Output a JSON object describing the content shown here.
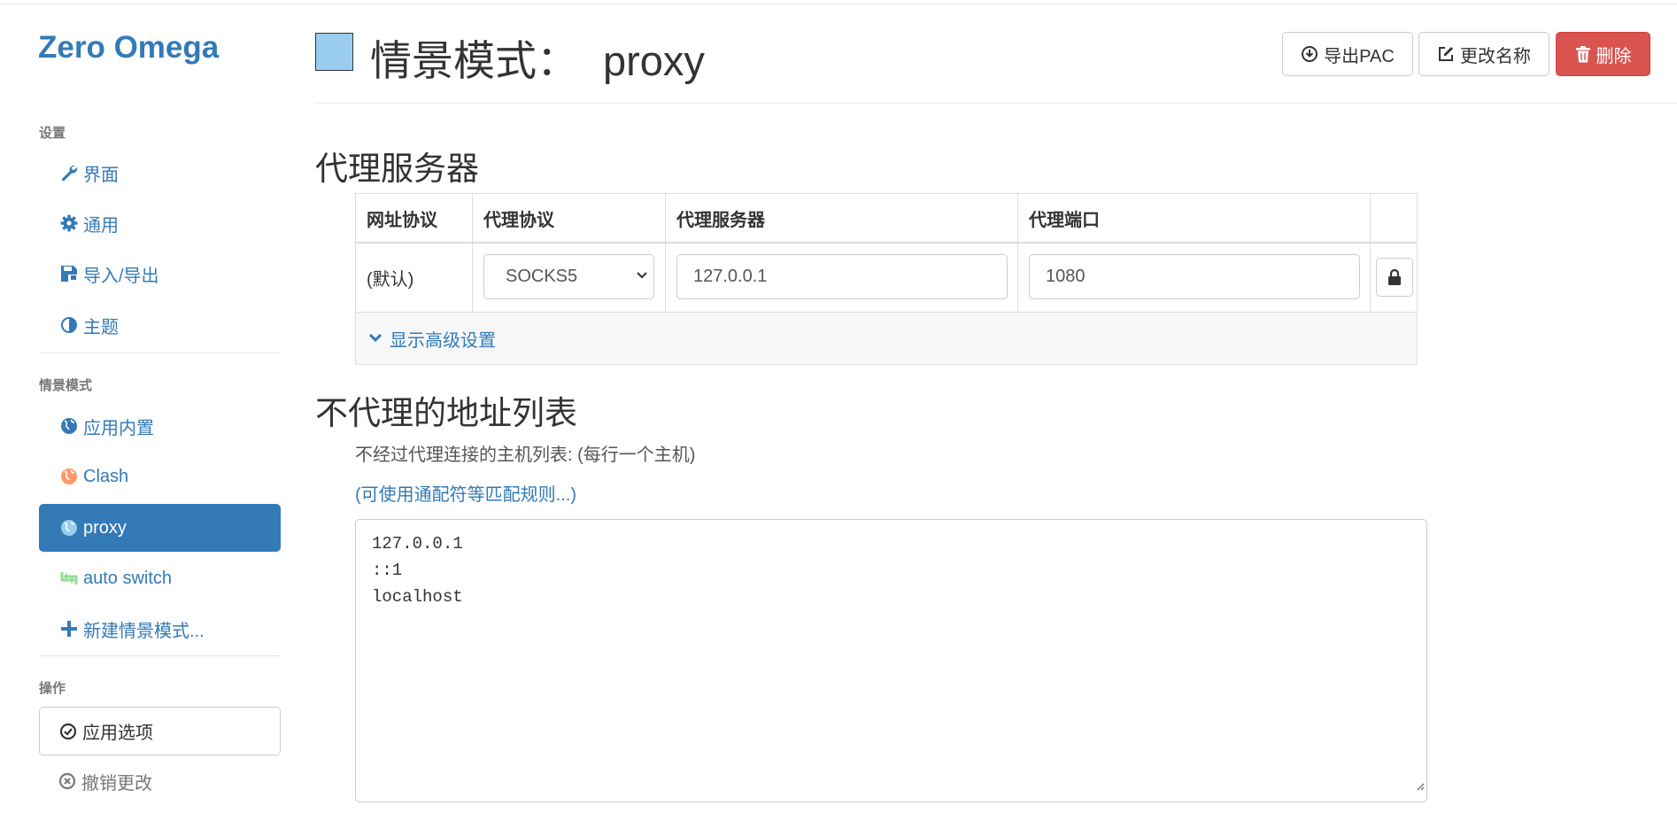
{
  "app": {
    "brand": "Zero Omega"
  },
  "sidebar": {
    "settings_header": "设置",
    "settings_items": [
      {
        "label": "界面",
        "icon": "wrench-icon"
      },
      {
        "label": "通用",
        "icon": "gear-icon"
      },
      {
        "label": "导入/导出",
        "icon": "floppy-disk-icon"
      },
      {
        "label": "主题",
        "icon": "contrast-icon"
      }
    ],
    "profiles_header": "情景模式",
    "profiles": [
      {
        "label": "应用内置",
        "icon": "globe-icon",
        "color": "#337ab7"
      },
      {
        "label": "Clash",
        "icon": "globe-icon",
        "color": "#ff9966"
      },
      {
        "label": "proxy",
        "icon": "globe-icon",
        "color": "#99ccee",
        "active": true
      },
      {
        "label": "auto switch",
        "icon": "switch-arrows-icon",
        "color": "#99dd99"
      },
      {
        "label": "新建情景模式...",
        "icon": "plus-icon"
      }
    ],
    "actions_header": "操作",
    "apply_label": "应用选项",
    "undo_label": "撤销更改"
  },
  "header": {
    "title_prefix": "情景模式：",
    "profile_name": "proxy",
    "profile_color": "#99ccee",
    "export_pac_label": "导出PAC",
    "rename_label": "更改名称",
    "delete_label": "删除"
  },
  "proxy_server": {
    "heading": "代理服务器",
    "columns": [
      "网址协议",
      "代理协议",
      "代理服务器",
      "代理端口"
    ],
    "row": {
      "scheme": "(默认)",
      "protocol": "SOCKS5",
      "server": "127.0.0.1",
      "port": "1080"
    },
    "advanced_label": "显示高级设置"
  },
  "bypass": {
    "heading": "不代理的地址列表",
    "help_text": "不经过代理连接的主机列表: (每行一个主机)",
    "wildcard_link": "(可使用通配符等匹配规则...)",
    "list": "127.0.0.1\n::1\nlocalhost"
  }
}
